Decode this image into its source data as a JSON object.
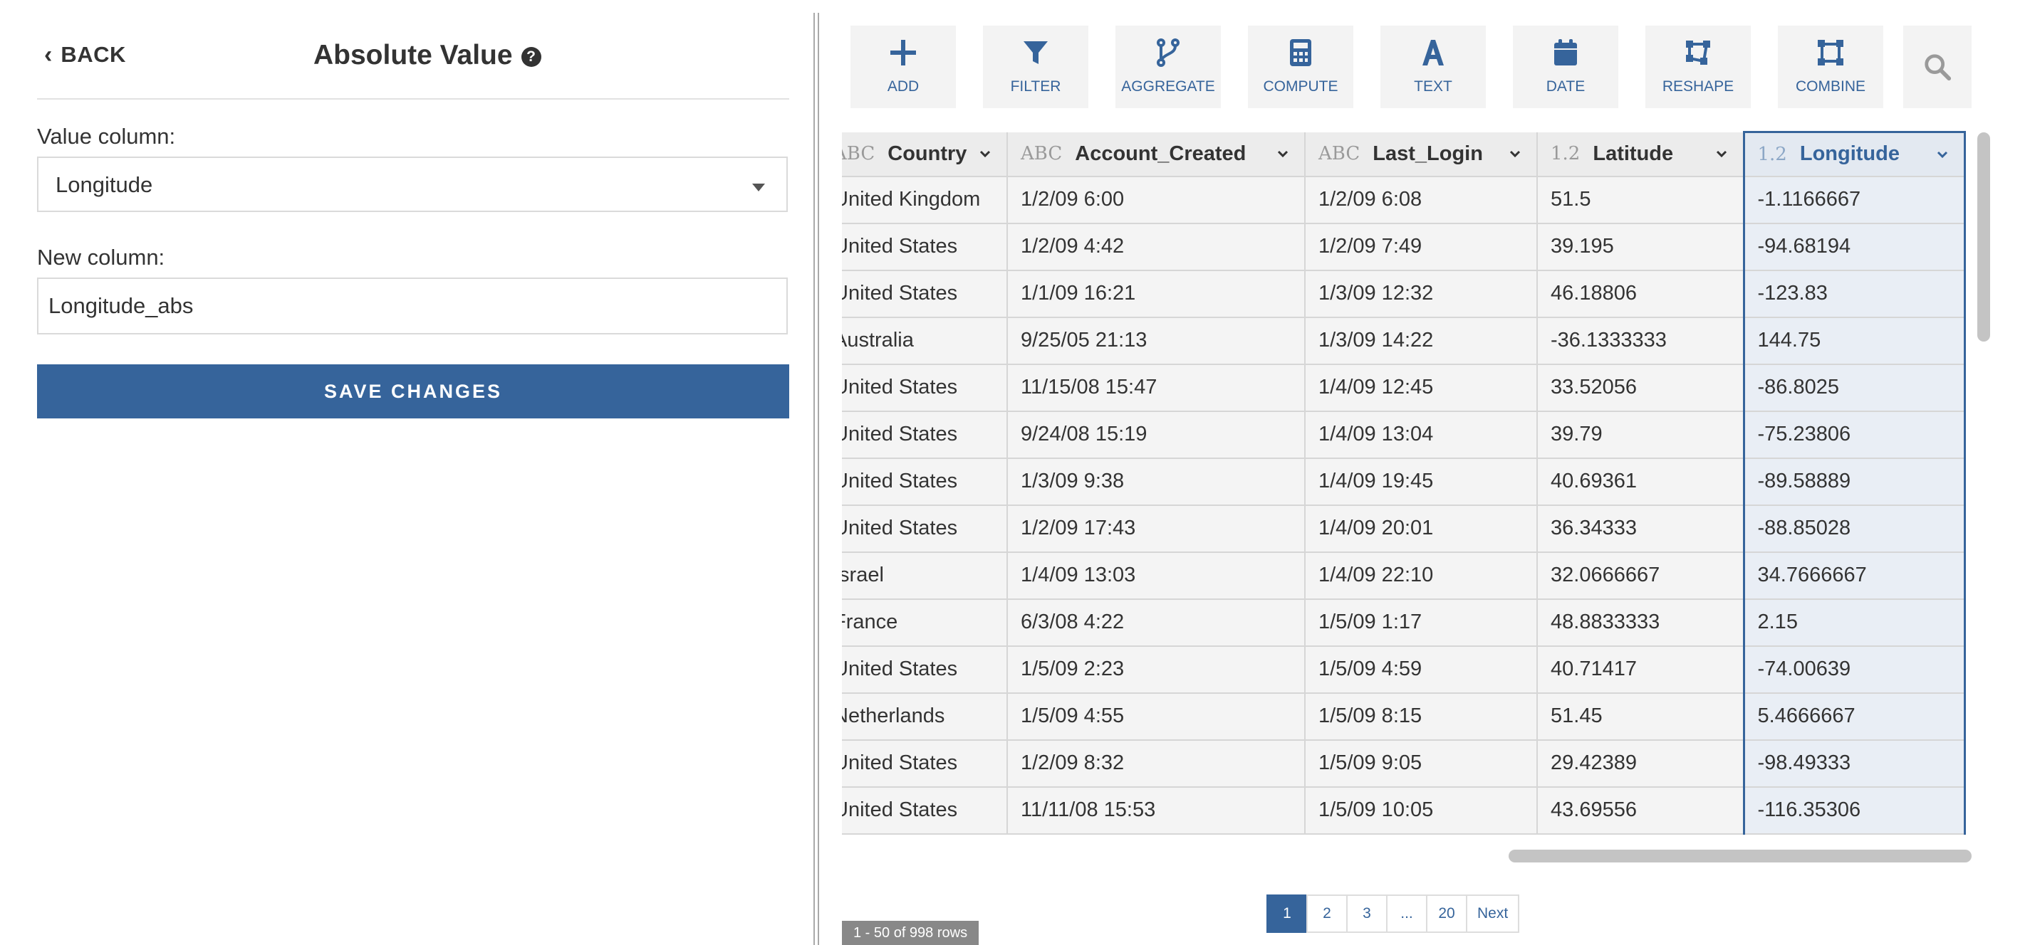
{
  "left": {
    "back_label": "BACK",
    "title": "Absolute Value",
    "help_icon": "?",
    "value_column_label": "Value column:",
    "value_column_selected": "Longitude",
    "new_column_label": "New column:",
    "new_column_value": "Longitude_abs",
    "save_label": "SAVE CHANGES"
  },
  "toolbar": [
    {
      "label": "ADD",
      "icon": "plus-icon"
    },
    {
      "label": "FILTER",
      "icon": "filter-icon"
    },
    {
      "label": "AGGREGATE",
      "icon": "aggregate-icon"
    },
    {
      "label": "COMPUTE",
      "icon": "calculator-icon"
    },
    {
      "label": "TEXT",
      "icon": "text-icon"
    },
    {
      "label": "DATE",
      "icon": "calendar-icon"
    },
    {
      "label": "RESHAPE",
      "icon": "reshape-icon"
    },
    {
      "label": "COMBINE",
      "icon": "combine-icon"
    }
  ],
  "accent_color": "#36649b",
  "grid": {
    "columns": [
      {
        "type": "ABC",
        "name": "Country"
      },
      {
        "type": "ABC",
        "name": "Account_Created"
      },
      {
        "type": "ABC",
        "name": "Last_Login"
      },
      {
        "type": "1.2",
        "name": "Latitude"
      },
      {
        "type": "1.2",
        "name": "Longitude"
      }
    ],
    "rows": [
      [
        "United Kingdom",
        "1/2/09 6:00",
        "1/2/09 6:08",
        "51.5",
        "-1.1166667"
      ],
      [
        "United States",
        "1/2/09 4:42",
        "1/2/09 7:49",
        "39.195",
        "-94.68194"
      ],
      [
        "United States",
        "1/1/09 16:21",
        "1/3/09 12:32",
        "46.18806",
        "-123.83"
      ],
      [
        "Australia",
        "9/25/05 21:13",
        "1/3/09 14:22",
        "-36.1333333",
        "144.75"
      ],
      [
        "United States",
        "11/15/08 15:47",
        "1/4/09 12:45",
        "33.52056",
        "-86.8025"
      ],
      [
        "United States",
        "9/24/08 15:19",
        "1/4/09 13:04",
        "39.79",
        "-75.23806"
      ],
      [
        "United States",
        "1/3/09 9:38",
        "1/4/09 19:45",
        "40.69361",
        "-89.58889"
      ],
      [
        "United States",
        "1/2/09 17:43",
        "1/4/09 20:01",
        "36.34333",
        "-88.85028"
      ],
      [
        "Israel",
        "1/4/09 13:03",
        "1/4/09 22:10",
        "32.0666667",
        "34.7666667"
      ],
      [
        "France",
        "6/3/08 4:22",
        "1/5/09 1:17",
        "48.8833333",
        "2.15"
      ],
      [
        "United States",
        "1/5/09 2:23",
        "1/5/09 4:59",
        "40.71417",
        "-74.00639"
      ],
      [
        "Netherlands",
        "1/5/09 4:55",
        "1/5/09 8:15",
        "51.45",
        "5.4666667"
      ],
      [
        "United States",
        "1/2/09 8:32",
        "1/5/09 9:05",
        "29.42389",
        "-98.49333"
      ],
      [
        "United States",
        "11/11/08 15:53",
        "1/5/09 10:05",
        "43.69556",
        "-116.35306"
      ]
    ]
  },
  "pagination": {
    "pages": [
      "1",
      "2",
      "3",
      "...",
      "20"
    ],
    "next_label": "Next",
    "row_count": "1 - 50 of 998 rows"
  }
}
